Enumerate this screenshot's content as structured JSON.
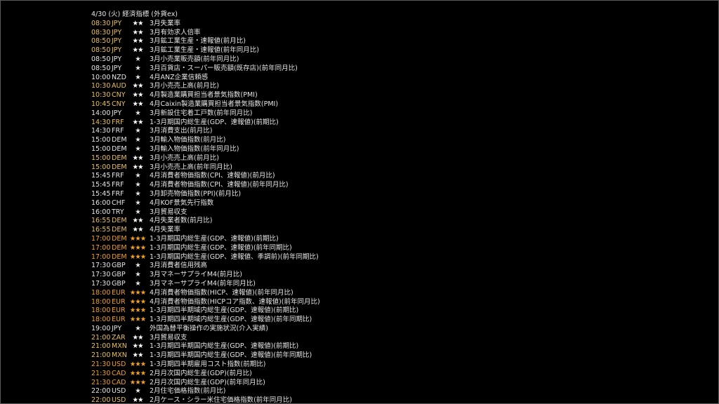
{
  "calendar": {
    "title": "4/30 (火) 経済指標 (外貨ex)",
    "star_glyph": "★",
    "colors": {
      "background": "#000000",
      "text": "#e6e6e6",
      "importance2": "#e8c15a",
      "importance3": "#f0a11e"
    },
    "rows": [
      {
        "time": "08:30",
        "currency": "JPY",
        "importance": 2,
        "event": "3月失業率"
      },
      {
        "time": "08:30",
        "currency": "JPY",
        "importance": 2,
        "event": "3月有効求人倍率"
      },
      {
        "time": "08:50",
        "currency": "JPY",
        "importance": 2,
        "event": "3月鉱工業生産・速報値(前月比)"
      },
      {
        "time": "08:50",
        "currency": "JPY",
        "importance": 2,
        "event": "3月鉱工業生産・速報値(前年同月比)"
      },
      {
        "time": "08:50",
        "currency": "JPY",
        "importance": 1,
        "event": "3月小売業販売額(前年同月比)"
      },
      {
        "time": "08:50",
        "currency": "JPY",
        "importance": 1,
        "event": "3月百貨店・スーパー販売額(既存店)(前年同月比)"
      },
      {
        "time": "10:00",
        "currency": "NZD",
        "importance": 1,
        "event": "4月ANZ企業信頼感"
      },
      {
        "time": "10:30",
        "currency": "AUD",
        "importance": 2,
        "event": "3月小売売上高(前月比)"
      },
      {
        "time": "10:30",
        "currency": "CNY",
        "importance": 2,
        "event": "4月製造業購買担当者景気指数(PMI)"
      },
      {
        "time": "10:45",
        "currency": "CNY",
        "importance": 2,
        "event": "4月Caixin製造業購買担当者景気指数(PMI)"
      },
      {
        "time": "14:00",
        "currency": "JPY",
        "importance": 1,
        "event": "3月新設住宅着工戸数(前年同月比)"
      },
      {
        "time": "14:30",
        "currency": "FRF",
        "importance": 2,
        "event": "1-3月期国内総生産(GDP、速報値)(前期比)"
      },
      {
        "time": "14:30",
        "currency": "FRF",
        "importance": 1,
        "event": "3月消費支出(前月比)"
      },
      {
        "time": "15:00",
        "currency": "DEM",
        "importance": 1,
        "event": "3月輸入物価指数(前月比)"
      },
      {
        "time": "15:00",
        "currency": "DEM",
        "importance": 1,
        "event": "3月輸入物価指数(前年同月比)"
      },
      {
        "time": "15:00",
        "currency": "DEM",
        "importance": 2,
        "event": "3月小売売上高(前月比)"
      },
      {
        "time": "15:00",
        "currency": "DEM",
        "importance": 2,
        "event": "3月小売売上高(前年同月比)"
      },
      {
        "time": "15:45",
        "currency": "FRF",
        "importance": 1,
        "event": "4月消費者物価指数(CPI、速報値)(前月比)"
      },
      {
        "time": "15:45",
        "currency": "FRF",
        "importance": 1,
        "event": "4月消費者物価指数(CPI、速報値)(前年同月比)"
      },
      {
        "time": "15:45",
        "currency": "FRF",
        "importance": 1,
        "event": "3月卸売物価指数(PPI)(前月比)"
      },
      {
        "time": "16:00",
        "currency": "CHF",
        "importance": 1,
        "event": "4月KOF景気先行指数"
      },
      {
        "time": "16:00",
        "currency": "TRY",
        "importance": 1,
        "event": "3月貿易収支"
      },
      {
        "time": "16:55",
        "currency": "DEM",
        "importance": 2,
        "event": "4月失業者数(前月比)"
      },
      {
        "time": "16:55",
        "currency": "DEM",
        "importance": 2,
        "event": "4月失業率"
      },
      {
        "time": "17:00",
        "currency": "DEM",
        "importance": 3,
        "event": "1-3月期国内総生産(GDP、速報値)(前期比)"
      },
      {
        "time": "17:00",
        "currency": "DEM",
        "importance": 3,
        "event": "1-3月期国内総生産(GDP、速報値)(前年同期比)"
      },
      {
        "time": "17:00",
        "currency": "DEM",
        "importance": 3,
        "event": "1-3月期国内総生産(GDP、速報値、季調前)(前年同期比)"
      },
      {
        "time": "17:30",
        "currency": "GBP",
        "importance": 1,
        "event": "3月消費者信用残高"
      },
      {
        "time": "17:30",
        "currency": "GBP",
        "importance": 1,
        "event": "3月マネーサプライM4(前月比)"
      },
      {
        "time": "17:30",
        "currency": "GBP",
        "importance": 1,
        "event": "3月マネーサプライM4(前年同月比)"
      },
      {
        "time": "18:00",
        "currency": "EUR",
        "importance": 3,
        "event": "4月消費者物価指数(HICP、速報値)(前年同月比)"
      },
      {
        "time": "18:00",
        "currency": "EUR",
        "importance": 3,
        "event": "4月消費者物価指数(HICPコア指数、速報値)(前年同月比)"
      },
      {
        "time": "18:00",
        "currency": "EUR",
        "importance": 3,
        "event": "1-3月期四半期域内総生産(GDP、速報値)(前期比)"
      },
      {
        "time": "18:00",
        "currency": "EUR",
        "importance": 3,
        "event": "1-3月期四半期域内総生産(GDP、速報値)(前年同期比)"
      },
      {
        "time": "19:00",
        "currency": "JPY",
        "importance": 1,
        "event": "外国為替平衡操作の実施状況(介入実績)"
      },
      {
        "time": "21:00",
        "currency": "ZAR",
        "importance": 2,
        "event": "3月貿易収支"
      },
      {
        "time": "21:00",
        "currency": "MXN",
        "importance": 2,
        "event": "1-3月期四半期国内総生産(GDP、速報値)(前期比)"
      },
      {
        "time": "21:00",
        "currency": "MXN",
        "importance": 2,
        "event": "1-3月期四半期国内総生産(GDP、速報値)(前年同期比)"
      },
      {
        "time": "21:30",
        "currency": "USD",
        "importance": 3,
        "event": "1-3月期四半期雇用コスト指数(前期比)"
      },
      {
        "time": "21:30",
        "currency": "CAD",
        "importance": 3,
        "event": "2月月次国内総生産(GDP)(前月比)"
      },
      {
        "time": "21:30",
        "currency": "CAD",
        "importance": 3,
        "event": "2月月次国内総生産(GDP)(前年同月比)"
      },
      {
        "time": "22:00",
        "currency": "USD",
        "importance": 1,
        "event": "2月住宅価格指数(前月比)"
      },
      {
        "time": "22:00",
        "currency": "USD",
        "importance": 2,
        "event": "2月ケース・シラー米住宅価格指数(前年同月比)"
      }
    ]
  }
}
